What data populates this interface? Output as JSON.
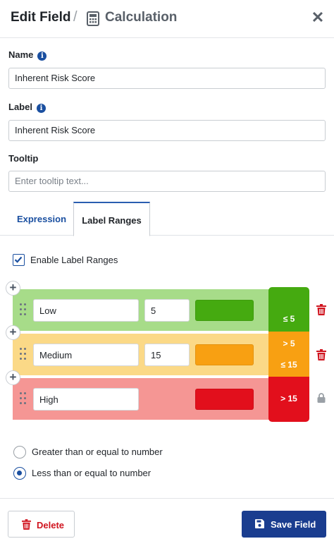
{
  "header": {
    "title": "Edit Field",
    "separator": "/",
    "subtitle": "Calculation",
    "subtitle_icon": "calculator-icon",
    "close_icon": "close-icon"
  },
  "form": {
    "name": {
      "label": "Name",
      "value": "Inherent Risk Score",
      "info_icon": "info-icon"
    },
    "label": {
      "label": "Label",
      "value": "Inherent Risk Score",
      "info_icon": "info-icon"
    },
    "tooltip": {
      "label": "Tooltip",
      "value": "",
      "placeholder": "Enter tooltip text..."
    }
  },
  "tabs": [
    {
      "label": "Expression",
      "active": false
    },
    {
      "label": "Label Ranges",
      "active": true
    }
  ],
  "enable_label_ranges": {
    "label": "Enable Label Ranges",
    "checked": true
  },
  "ranges": [
    {
      "name": "Low",
      "threshold": "5",
      "color": "#45aa10",
      "row_color": "#a7dc89",
      "legend": [
        "≤ 5"
      ],
      "action_icon": "trash-icon"
    },
    {
      "name": "Medium",
      "threshold": "15",
      "color": "#f8a012",
      "row_color": "#fbd987",
      "legend": [
        "> 5",
        "≤ 15"
      ],
      "action_icon": "trash-icon"
    },
    {
      "name": "High",
      "threshold": "",
      "color": "#e20f1c",
      "row_color": "#f59694",
      "legend": [
        "> 15"
      ],
      "action_icon": "lock-icon"
    }
  ],
  "comparison": {
    "options": [
      {
        "label": "Greater than or equal to number",
        "selected": false
      },
      {
        "label": "Less than or equal to number",
        "selected": true
      }
    ]
  },
  "footer": {
    "delete_label": "Delete",
    "save_label": "Save Field",
    "delete_color": "#d0141f",
    "save_color": "#1a3d8f"
  }
}
